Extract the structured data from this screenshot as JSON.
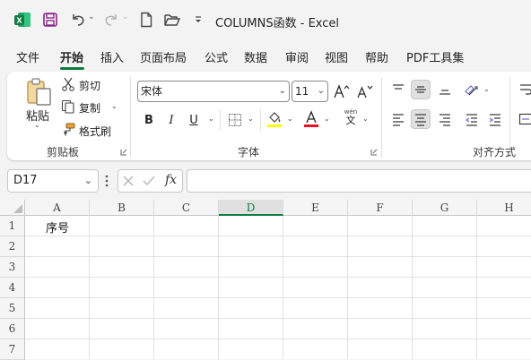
{
  "app": {
    "title": "COLUMNS函数  -  Excel",
    "brand_color": "#117a41"
  },
  "menu": {
    "tabs": [
      "文件",
      "开始",
      "插入",
      "页面布局",
      "公式",
      "数据",
      "审阅",
      "视图",
      "帮助",
      "PDF工具集"
    ]
  },
  "ribbon": {
    "clipboard": {
      "paste": "粘贴",
      "cut": "剪切",
      "copy": "复制",
      "format_painter": "格式刷",
      "group_label": "剪贴板"
    },
    "font": {
      "font_name": "宋体",
      "font_size": "11",
      "group_label": "字体",
      "bold": "B",
      "italic": "I",
      "underline": "U",
      "phonetic_top": "wén",
      "phonetic_bottom": "文"
    },
    "alignment": {
      "group_label": "对齐方式"
    }
  },
  "formula_bar": {
    "name_box": "D17",
    "fx": "fx",
    "formula": ""
  },
  "sheet": {
    "columns": [
      "A",
      "B",
      "C",
      "D",
      "E",
      "F",
      "G",
      "H"
    ],
    "selected_column": "D",
    "rows": [
      "1",
      "2",
      "3",
      "4",
      "5",
      "6",
      "7"
    ],
    "cells": {
      "A1": "序号"
    }
  }
}
